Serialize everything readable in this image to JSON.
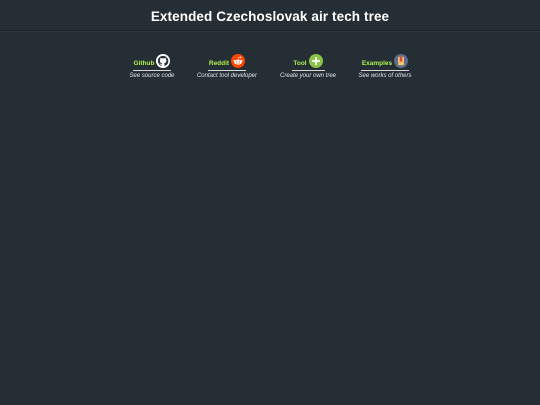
{
  "header": {
    "title": "Extended Czechoslovak air tech tree"
  },
  "links": [
    {
      "label": "Github",
      "description": "See source code",
      "icon": "github-icon"
    },
    {
      "label": "Reddit",
      "description": "Contact tool developer",
      "icon": "reddit-icon"
    },
    {
      "label": "Tool",
      "description": "Create your own tree",
      "icon": "plus-icon"
    },
    {
      "label": "Examples",
      "description": "See works of others",
      "icon": "bookmark-icon"
    }
  ],
  "colors": {
    "background": "#242e34",
    "link_label": "#aef04f",
    "reddit": "#ff4500",
    "tool": "#8bc34a",
    "examples": "#5b6e8c"
  }
}
